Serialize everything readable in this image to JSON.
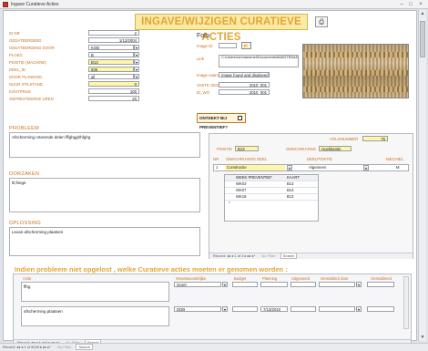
{
  "window": {
    "title": "Ingave Curatieve Acties",
    "min": "–",
    "max": "□",
    "close": "×"
  },
  "header": {
    "title": "INGAVE/WIJZIGEN CURATIEVE ACTIES",
    "icon": "print-icon"
  },
  "fields": [
    {
      "label": "ID nr",
      "value": "2",
      "align": "right"
    },
    {
      "label": "GEDATEERDEND",
      "value": "1/12/2004",
      "align": "right"
    },
    {
      "label": "GEDATEERDEND DOOR",
      "value": "KOB",
      "dropdown": true
    },
    {
      "label": "PLOEG",
      "value": "B",
      "dropdown": true
    },
    {
      "label": "POSITIE (Machine)",
      "value": "B13",
      "dropdown": true,
      "yellow": true
    },
    {
      "label": "DEEL_ID",
      "value": "835",
      "dropdown": true,
      "yellow": true
    },
    {
      "label": "DOOR PLANNING",
      "value": "all",
      "dropdown": true
    },
    {
      "label": "DUUR STILSTAND",
      "value": "0",
      "align": "right",
      "yellow": true
    },
    {
      "label": "KOSTPRIJS",
      "value": "100",
      "align": "right"
    },
    {
      "label": "GEPRESTEERDE UREN",
      "value": "20",
      "align": "right"
    }
  ],
  "foto": {
    "title": "Foto",
    "imageid_label": "Image ID",
    "imageid_value": "",
    "link_label": "Link",
    "link_value": "C:\\Users\\ronmansmei\\Documents\\MAINTENANCE\\FOTOS\\plaatsnl.jpg",
    "naam_label": "Image naam",
    "naam_value": "Image found and displayed",
    "vaste_label": "VASTE GEGEVENS",
    "vaste_value": "2010_001",
    "sel_label": "ID_WO",
    "sel_value": "2010_001"
  },
  "button_preventief": "ONTDEKT BIJ PREVENTIEF?",
  "sections": {
    "probleem": {
      "title": "PROBLEEM",
      "text": "Afscherming roterende delen fffghgghhfghg"
    },
    "oorzaken": {
      "title": "OORZAKEN",
      "text": "kl;fsege"
    },
    "oplossing": {
      "title": "OPLOSSING",
      "text": "Lexan afscherming plaatsen"
    }
  },
  "sub_right": {
    "volgnummer_label": "VOLGNUMMER",
    "volgnummer_value": "76",
    "positie_label": "POSITIE",
    "positie_value": "B13",
    "omschrijving_label": "OMSCHRIJVING",
    "omschrijving_value": "Hoekkantie",
    "col_nr": "NR",
    "col_omschr": "OMSCHRIJVING DEEL",
    "col_deelpositie": "DEELPOSITIE",
    "col_mechiel": "MECHIEL",
    "row1": {
      "nr": "1",
      "omschr": "Constructie",
      "deelpos": "Algemeen",
      "mech": "M"
    },
    "inner_cols": [
      "WEEK PREVENTIEF",
      "KAART"
    ],
    "inner_rows": [
      {
        "week": "WK03",
        "kaart": "B13"
      },
      {
        "week": "WK07",
        "kaart": "B13"
      },
      {
        "week": "WK18",
        "kaart": "B13"
      }
    ],
    "nav": "Record: ◂◂ ◂ 1 of 3 ▸ ▸▸ ▸*",
    "nofilter": "No Filter",
    "search": "Search"
  },
  "bottom": {
    "title": "Indien probleem niet opgelost , welke Curatieve acties moeten er genomen worden :",
    "cols": [
      "Actie",
      "Verantwoordelijke",
      "Budget",
      "Planning",
      "Uitgevoerd",
      "Gereablerd door",
      "Gereableerd"
    ],
    "rows": [
      {
        "actie": "ffhg",
        "verant": "Geert",
        "budget": "",
        "planning": "",
        "uitgevoerd": "",
        "door": "",
        "ger": ""
      },
      {
        "actie": "afscherming plaatsen",
        "verant": "DDB",
        "budget": "",
        "planning": "7/13/2010",
        "uitgevoerd": "",
        "door": "",
        "ger": ""
      }
    ],
    "nav": "Record: ◂◂ ◂ 4 of 6 ▸ ▸▸ ▸*",
    "nofilter": "No Filter",
    "search": "Search"
  },
  "status": {
    "nav": "Record: ◂◂ ◂ 1 of 5049 ▸ ▸▸ ▸*",
    "nofilter": "No Filter",
    "search": "Search"
  }
}
